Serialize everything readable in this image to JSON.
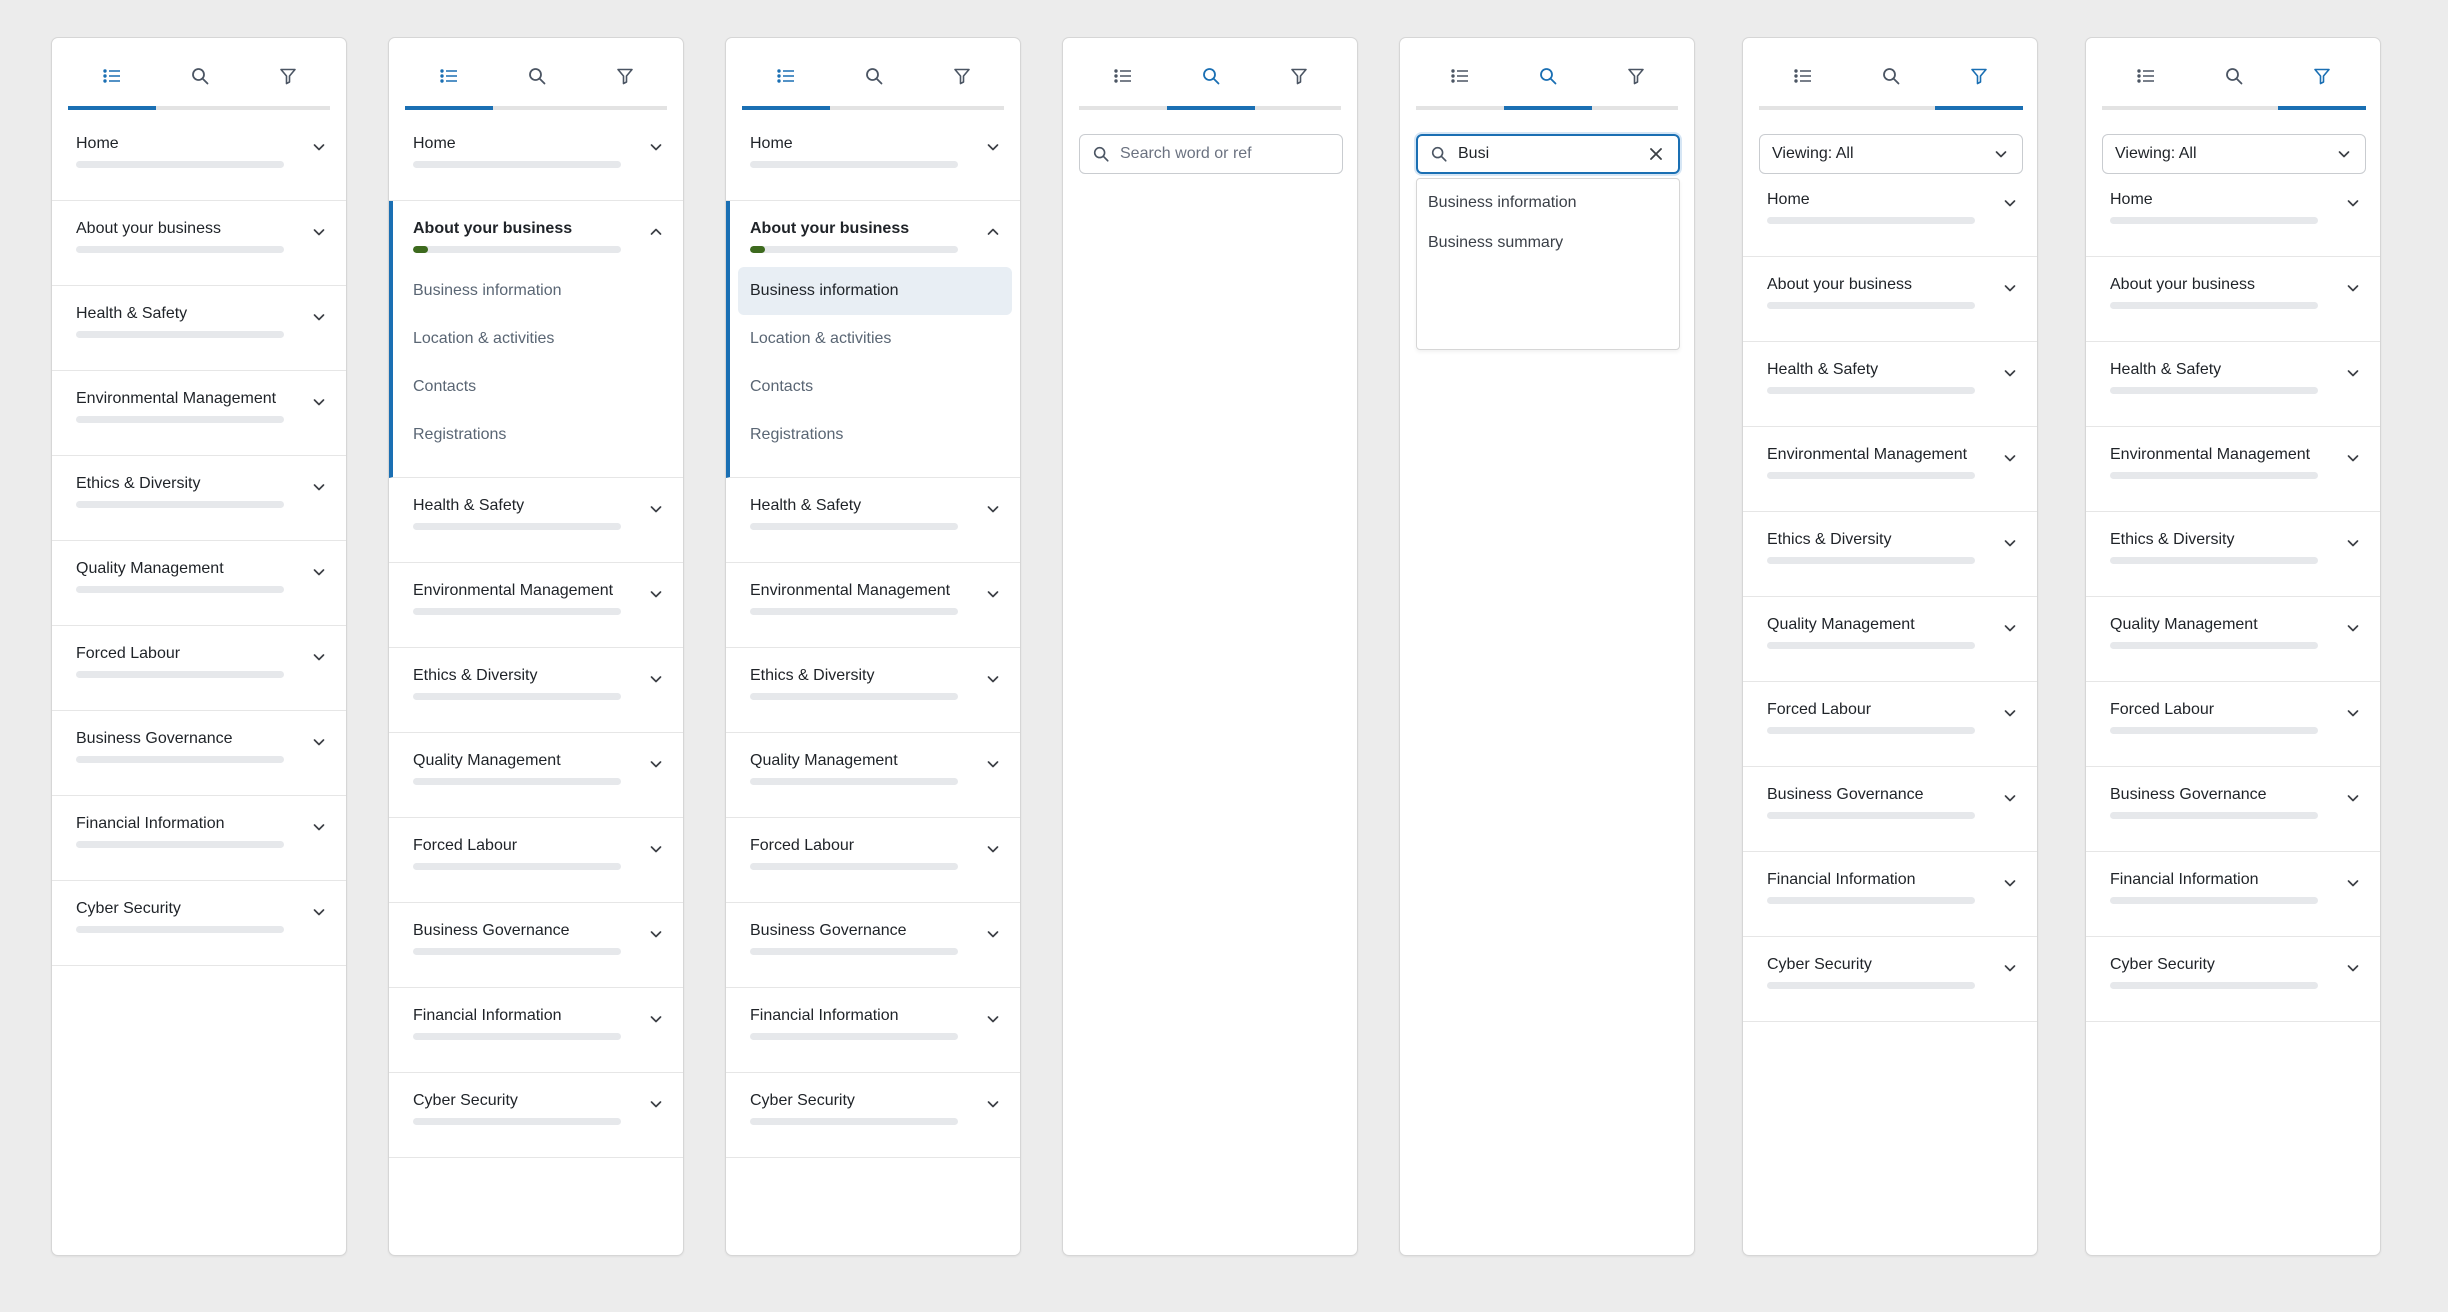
{
  "tabs": {
    "list_icon": "list-icon",
    "search_icon": "search-icon",
    "filter_icon": "filter-icon"
  },
  "accent_color": "#1a6fb3",
  "progress_color": "#3d6a1e",
  "sections": [
    "Home",
    "About your business",
    "Health & Safety",
    "Environmental Management",
    "Ethics & Diversity",
    "Quality Management",
    "Forced Labour",
    "Business Governance",
    "Financial Information",
    "Cyber Security"
  ],
  "about_progress": 0.07,
  "about_subitems": [
    "Business information",
    "Location & activities",
    "Contacts",
    "Registrations"
  ],
  "search": {
    "placeholder": "Search word or ref",
    "query": "Busi",
    "suggestions": [
      "Business information",
      "Business summary"
    ]
  },
  "filter": {
    "viewing_label": "Viewing: All"
  },
  "panels": [
    {
      "view": "list",
      "active_tab": "list",
      "expanded": -1,
      "selected_sub": -1
    },
    {
      "view": "list",
      "active_tab": "list",
      "expanded": 1,
      "selected_sub": -1
    },
    {
      "view": "list",
      "active_tab": "list",
      "expanded": 1,
      "selected_sub": 0
    },
    {
      "view": "search-empty",
      "active_tab": "search"
    },
    {
      "view": "search-results",
      "active_tab": "search"
    },
    {
      "view": "filter",
      "active_tab": "filter",
      "expanded": -1,
      "selected_sub": -1
    },
    {
      "view": "filter",
      "active_tab": "filter",
      "expanded": -1,
      "selected_sub": -1
    }
  ]
}
